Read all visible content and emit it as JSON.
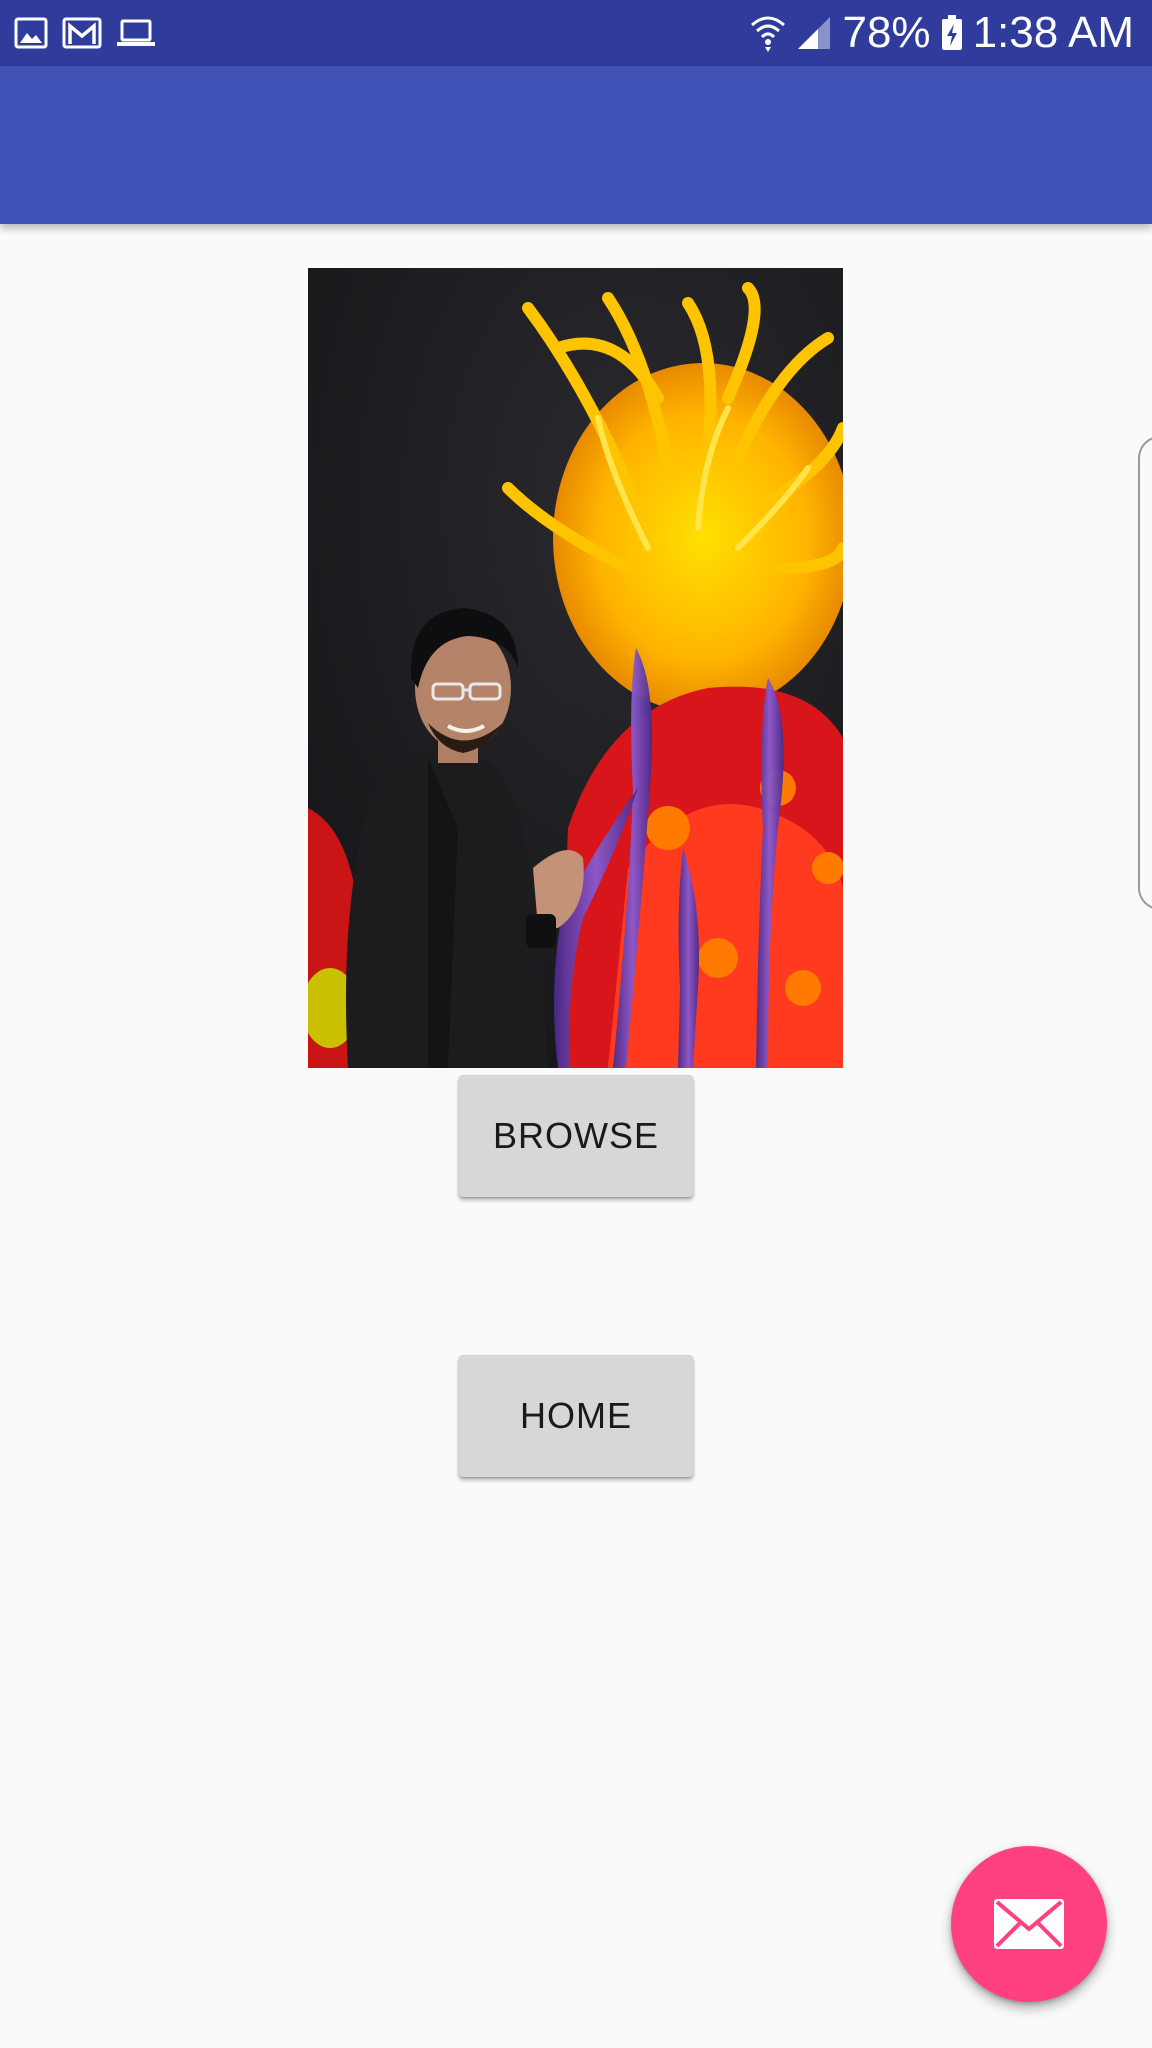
{
  "status_bar": {
    "left_icons": [
      "gallery-icon",
      "gmail-icon",
      "laptop-icon"
    ],
    "right_icons": [
      "wifi-icon",
      "signal-icon",
      "battery-charging-icon"
    ],
    "battery_percent": "78%",
    "time": "1:38 AM"
  },
  "toolbar": {
    "title": ""
  },
  "photo": {
    "subject": "photo-image"
  },
  "buttons": {
    "browse_label": "BROWSE",
    "home_label": "HOME"
  },
  "fab": {
    "icon": "email-icon"
  },
  "colors": {
    "status_bar": "#2f3c9b",
    "toolbar": "#3f51b5",
    "background": "#fafafa",
    "button": "#d6d7d7",
    "fab": "#ff4081"
  }
}
